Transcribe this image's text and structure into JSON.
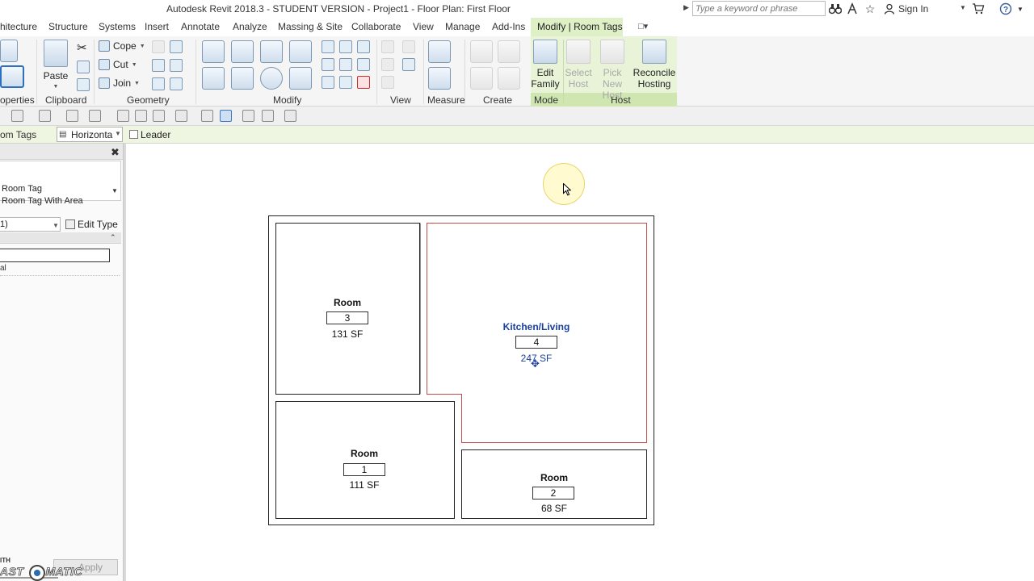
{
  "title_bar": {
    "title": "Autodesk Revit 2018.3 - STUDENT VERSION -    Project1 - Floor Plan: First Floor",
    "search_placeholder": "Type a keyword or phrase",
    "sign_in": "Sign In"
  },
  "tabs": [
    {
      "label": "hitecture"
    },
    {
      "label": "Structure"
    },
    {
      "label": "Systems"
    },
    {
      "label": "Insert"
    },
    {
      "label": "Annotate"
    },
    {
      "label": "Analyze"
    },
    {
      "label": "Massing & Site"
    },
    {
      "label": "Collaborate"
    },
    {
      "label": "View"
    },
    {
      "label": "Manage"
    },
    {
      "label": "Add-Ins"
    },
    {
      "label": "Modify | Room Tags"
    }
  ],
  "ribbon": {
    "clipboard": {
      "paste": "Paste"
    },
    "geometry": {
      "cope": "Cope",
      "cut": "Cut",
      "join": "Join"
    },
    "mode": {
      "edit_family_l1": "Edit",
      "edit_family_l2": "Family"
    },
    "host": {
      "select_host_l1": "Select",
      "select_host_l2": "Host",
      "pick_new_host_l1": "Pick New",
      "pick_new_host_l2": "Host",
      "reconcile_l1": "Reconcile",
      "reconcile_l2": "Hosting"
    },
    "panels": {
      "properties": "operties",
      "clipboard": "Clipboard",
      "geometry": "Geometry",
      "modify": "Modify",
      "view": "View",
      "measure": "Measure",
      "create": "Create",
      "mode": "Mode",
      "host": "Host"
    }
  },
  "options_bar": {
    "context_label": "om Tags",
    "orientation": "Horizonta",
    "leader_label": "Leader",
    "leader_checked": false
  },
  "properties": {
    "type_family": "Room Tag",
    "type_name": "Room Tag With Area",
    "instance_filter": "1)",
    "edit_type": "Edit Type",
    "value": "al",
    "apply": "Apply"
  },
  "watermark": {
    "small": "ITH",
    "left": "AST",
    "right": "MATIC"
  },
  "rooms": [
    {
      "name": "Room",
      "number": "3",
      "area": "131 SF",
      "selected": false
    },
    {
      "name": "Kitchen/Living",
      "number": "4",
      "area": "247 SF",
      "selected": true
    },
    {
      "name": "Room",
      "number": "1",
      "area": "111 SF",
      "selected": false
    },
    {
      "name": "Room",
      "number": "2",
      "area": "68 SF",
      "selected": false
    }
  ],
  "colors": {
    "context_tab": "#dff0c7",
    "options_bar": "#eef6e2",
    "room_boundary_selected": "#c84a4a",
    "selected_text": "#1a3f9e"
  }
}
